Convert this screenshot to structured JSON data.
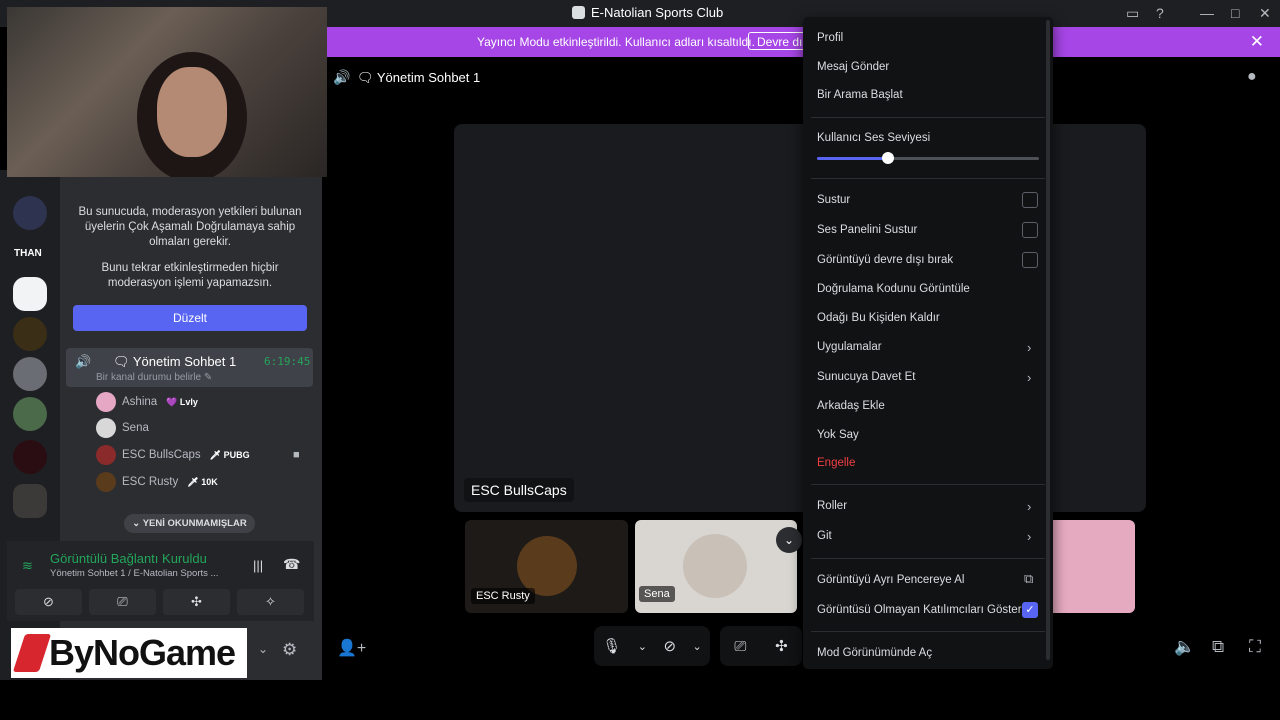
{
  "window": {
    "title": "E-Natolian Sports Club"
  },
  "banner": {
    "text": "Yayıncı Modu etkinleştirildi. Kullanıcı adları kısaltıldı.",
    "button": "Devre dışı"
  },
  "sidebar": {
    "server_text_label": "THAN",
    "mfa_notice_1": "Bu sunucuda, moderasyon yetkileri bulunan üyelerin Çok Aşamalı Doğrulamaya sahip olmaları gerekir.",
    "mfa_notice_2": "Bunu tekrar etkinleştirmeden hiçbir moderasyon işlemi yapamazsın.",
    "edit_button": "Düzelt",
    "voice_channel": {
      "name": "Yönetim Sohbet 1",
      "timer": "6:19:45",
      "status": "Bir kanal durumu belirle"
    },
    "members": [
      {
        "name": "Ashina",
        "tag": "Lvly"
      },
      {
        "name": "Sena",
        "tag": ""
      },
      {
        "name": "ESC BullsCaps",
        "tag": "PUBG"
      },
      {
        "name": "ESC Rusty",
        "tag": "10K"
      }
    ],
    "unread_pill": "YENİ OKUNMAMIŞLAR",
    "voice_status": {
      "label": "Görüntülü Bağlantı Kuruldu",
      "sub": "Yönetim Sohbet 1 / E-Natolian Sports ..."
    }
  },
  "logo": {
    "text": "ByNoGame"
  },
  "main": {
    "channel_name": "Yönetim Sohbet 1",
    "stage_label": "ESC BullsCaps",
    "tiles": [
      {
        "label": "ESC Rusty"
      },
      {
        "label": "Sena"
      }
    ]
  },
  "context_menu": {
    "profile": "Profil",
    "message": "Mesaj Gönder",
    "call": "Bir Arama Başlat",
    "volume_label": "Kullanıcı Ses Seviyesi",
    "volume_level": 0.32,
    "mute": "Sustur",
    "mute_soundboard": "Ses Panelini Sustur",
    "disable_video": "Görüntüyü devre dışı bırak",
    "verify_code": "Doğrulama Kodunu Görüntüle",
    "unfocus": "Odağı Bu Kişiden Kaldır",
    "apps": "Uygulamalar",
    "invite": "Sunucuya Davet Et",
    "add_friend": "Arkadaş Ekle",
    "ignore": "Yok Say",
    "block": "Engelle",
    "roles": "Roller",
    "go": "Git",
    "popout": "Görüntüyü Ayrı Pencereye Al",
    "show_non_video": "Görüntüsü Olmayan Katılımcıları Göster",
    "mod_view": "Mod Görünümünde Aç"
  },
  "colors": {
    "accent": "#5865f2",
    "banner": "#a646e6",
    "danger": "#f23f43",
    "online": "#23a55a"
  }
}
